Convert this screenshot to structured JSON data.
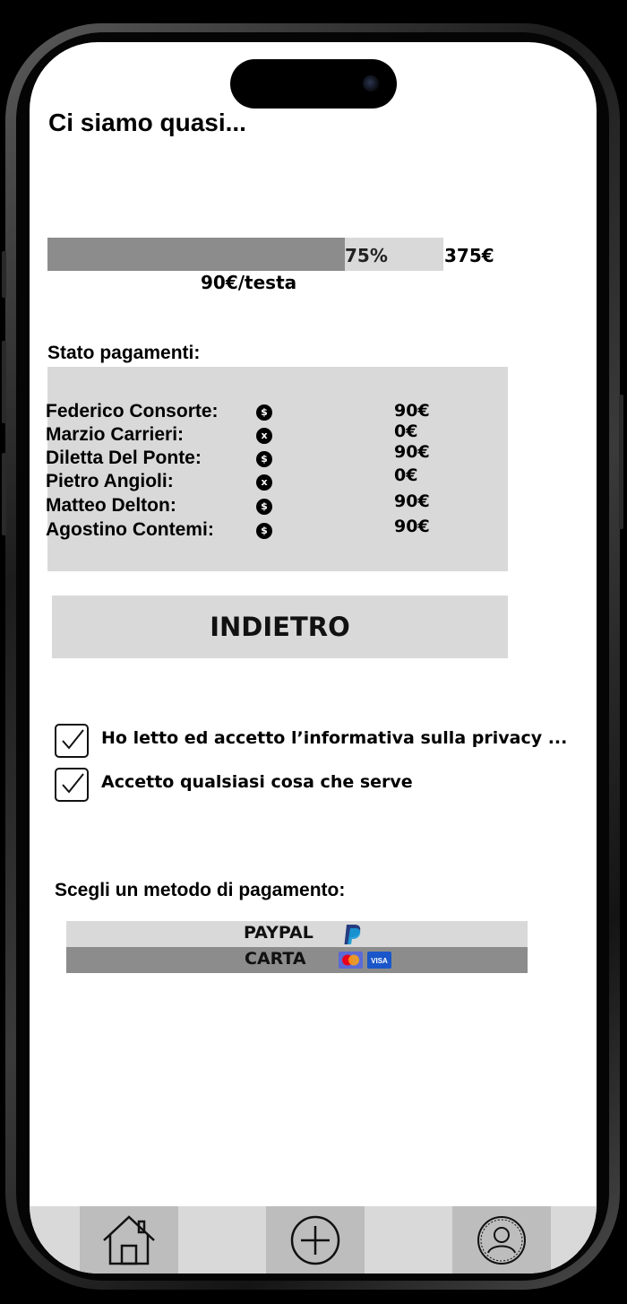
{
  "page": {
    "title": "Ci siamo quasi..."
  },
  "progress": {
    "percent_label": "75%",
    "value": 0.75,
    "goal": "375€",
    "per_head": "90€/testa"
  },
  "payments": {
    "heading": "Stato pagamenti:",
    "rows": [
      {
        "name": "Federico Consorte:",
        "status": "paid",
        "icon": "$",
        "amount": "90€"
      },
      {
        "name": "Marzio Carrieri:",
        "status": "unpaid",
        "icon": "x",
        "amount": "0€"
      },
      {
        "name": "Diletta Del Ponte:",
        "status": "paid",
        "icon": "$",
        "amount": "90€"
      },
      {
        "name": "Pietro Angioli:",
        "status": "unpaid",
        "icon": "x",
        "amount": "0€"
      },
      {
        "name": "Matteo Delton:",
        "status": "paid",
        "icon": "$",
        "amount": "90€"
      },
      {
        "name": "Agostino Contemi:",
        "status": "paid",
        "icon": "$",
        "amount": "90€"
      }
    ]
  },
  "actions": {
    "back_label": "INDIETRO"
  },
  "consents": [
    {
      "label": "Ho letto ed accetto l’informativa sulla privacy ...",
      "checked": true
    },
    {
      "label": "Accetto qualsiasi cosa che serve",
      "checked": true
    }
  ],
  "payment_methods": {
    "heading": "Scegli un metodo di pagamento:",
    "options": [
      {
        "label": "PAYPAL",
        "icon": "paypal-icon",
        "bg": "#d9d9d9"
      },
      {
        "label": "CARTA",
        "icon": "card-icons",
        "bg": "#8c8c8c"
      }
    ]
  },
  "nav": {
    "items": [
      "home-icon",
      "add-icon",
      "profile-icon"
    ]
  },
  "colors": {
    "light_gray": "#d9d9d9",
    "mid_gray": "#8c8c8c",
    "nav_active": "#bdbdbd",
    "paypal_blue": "#253b80",
    "paypal_light": "#179bd7",
    "visa_blue": "#1a56c9",
    "mc_red": "#eb001b",
    "mc_orange": "#f79e1b"
  }
}
